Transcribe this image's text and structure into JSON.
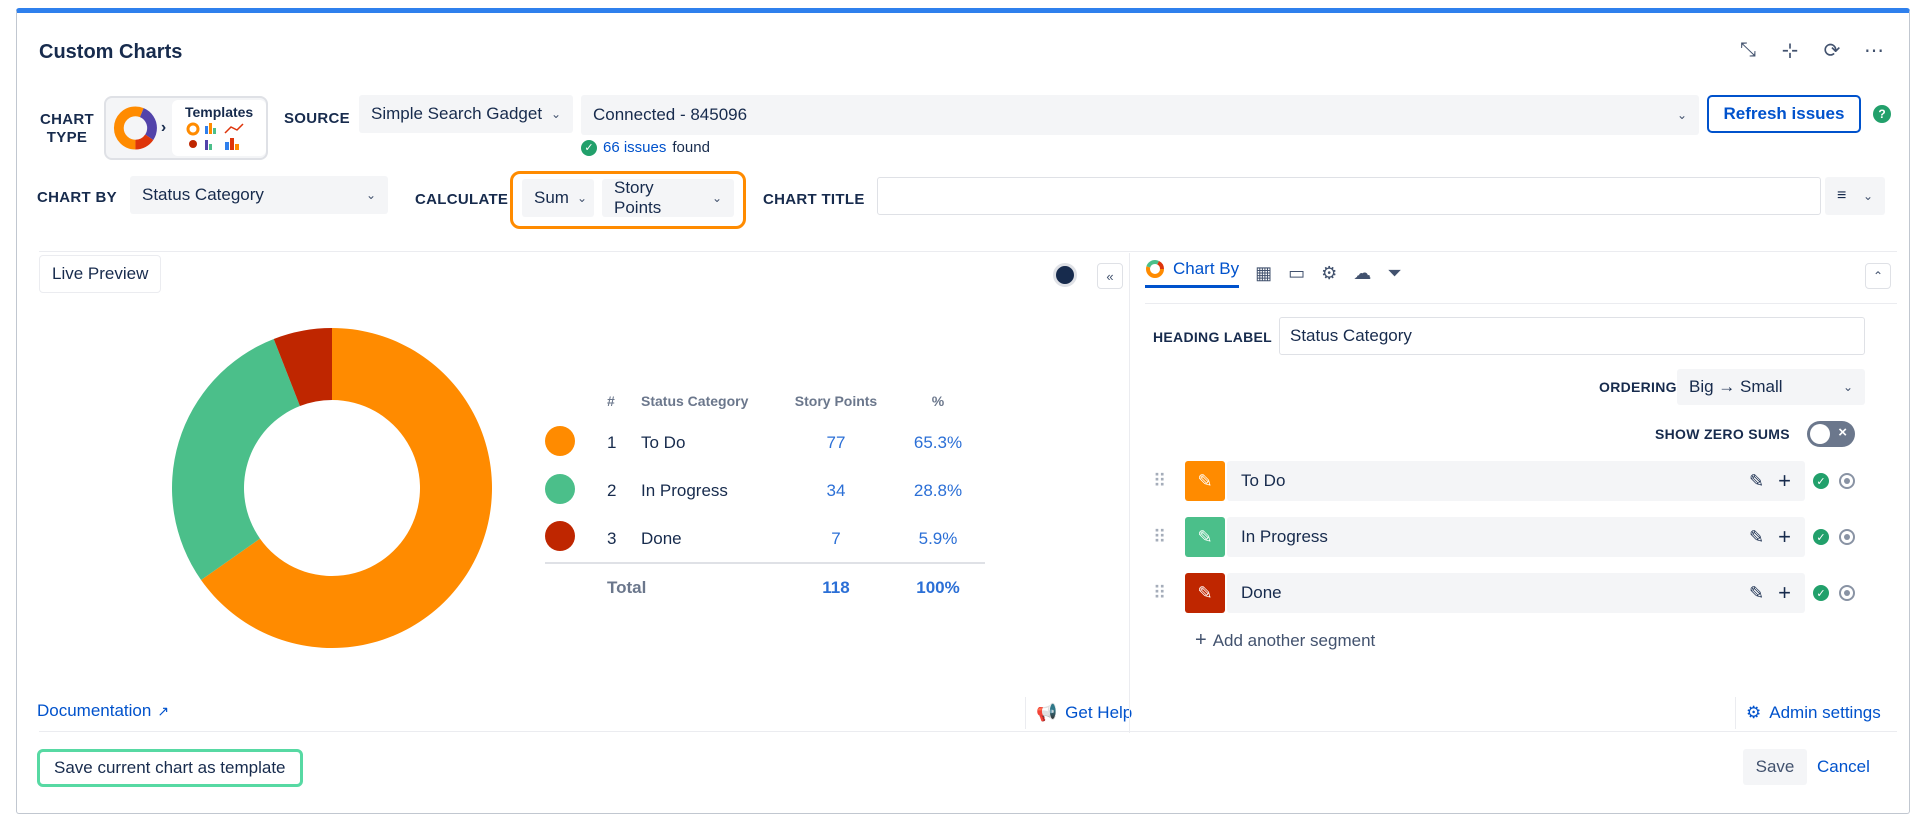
{
  "title": "Custom Charts",
  "header_icons": [
    "collapse-arrows-icon",
    "shrink-icon",
    "refresh-icon",
    "more-icon"
  ],
  "chart_type": {
    "label": "CHART TYPE",
    "templates_label": "Templates"
  },
  "source": {
    "label": "SOURCE",
    "value": "Simple Search Gadget",
    "connection": "Connected - 845096",
    "refresh_label": "Refresh issues",
    "issues_count": "66 issues",
    "issues_suffix": "found"
  },
  "chart_by": {
    "label": "CHART BY",
    "value": "Status Category"
  },
  "calculate": {
    "label": "CALCULATE",
    "func": "Sum",
    "field": "Story Points"
  },
  "chart_title": {
    "label": "CHART TITLE",
    "value": ""
  },
  "left": {
    "live_preview": "Live Preview",
    "documentation": "Documentation",
    "get_help": "Get Help"
  },
  "legend": {
    "headers": [
      "#",
      "Status Category",
      "Story Points",
      "%"
    ],
    "rows": [
      {
        "n": "1",
        "name": "To Do",
        "points": "77",
        "pct": "65.3%",
        "color": "#ff8b00"
      },
      {
        "n": "2",
        "name": "In Progress",
        "points": "34",
        "pct": "28.8%",
        "color": "#4bbf8a"
      },
      {
        "n": "3",
        "name": "Done",
        "points": "7",
        "pct": "5.9%",
        "color": "#bf2600"
      }
    ],
    "total_label": "Total",
    "total_points": "118",
    "total_pct": "100%"
  },
  "chart_data": {
    "type": "pie",
    "categories": [
      "To Do",
      "In Progress",
      "Done"
    ],
    "values": [
      77,
      34,
      7
    ],
    "colors": [
      "#ff8b00",
      "#4bbf8a",
      "#bf2600"
    ],
    "title": "",
    "donut": true
  },
  "right": {
    "tab_chart_by": "Chart By",
    "tab_icons": [
      "table-icon",
      "comment-icon",
      "gear-icon",
      "upload-icon",
      "filter-icon"
    ],
    "heading_label": "HEADING LABEL",
    "heading_value": "Status Category",
    "ordering_label": "ORDERING",
    "ordering_value": "Big → Small",
    "show_zero_label": "SHOW ZERO SUMS",
    "segments": [
      {
        "name": "To Do",
        "color": "#ff8b00"
      },
      {
        "name": "In Progress",
        "color": "#4bbf8a"
      },
      {
        "name": "Done",
        "color": "#bf2600"
      }
    ],
    "add_segment": "Add another segment",
    "admin_settings": "Admin settings"
  },
  "footer": {
    "save_template": "Save current chart as template",
    "save": "Save",
    "cancel": "Cancel"
  }
}
